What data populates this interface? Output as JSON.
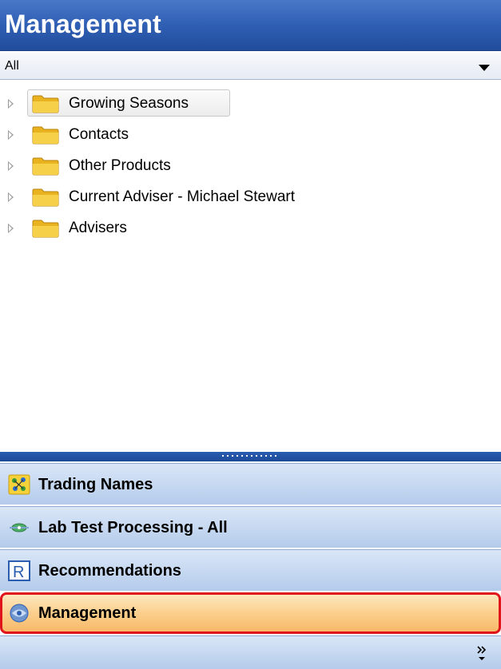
{
  "header": {
    "title": "Management"
  },
  "filter": {
    "value": "All"
  },
  "tree": {
    "items": [
      {
        "label": "Growing Seasons",
        "icon": "folder-icon",
        "selected": true
      },
      {
        "label": "Contacts",
        "icon": "folder-icon"
      },
      {
        "label": "Other Products",
        "icon": "folder-icon"
      },
      {
        "label": "Current Adviser - Michael Stewart",
        "icon": "folder-icon"
      },
      {
        "label": "Advisers",
        "icon": "folder-icon"
      }
    ]
  },
  "nav": {
    "items": [
      {
        "label": "Trading Names",
        "icon": "trading-names-icon"
      },
      {
        "label": "Lab Test Processing - All",
        "icon": "lab-test-icon"
      },
      {
        "label": "Recommendations",
        "icon": "recommendations-icon"
      },
      {
        "label": "Management",
        "icon": "management-icon",
        "active": true
      }
    ]
  },
  "colors": {
    "header": "#2f5fb3",
    "active_nav": "#fbcf8c",
    "highlight_border": "#e0151b",
    "folder": "#f2c230"
  }
}
